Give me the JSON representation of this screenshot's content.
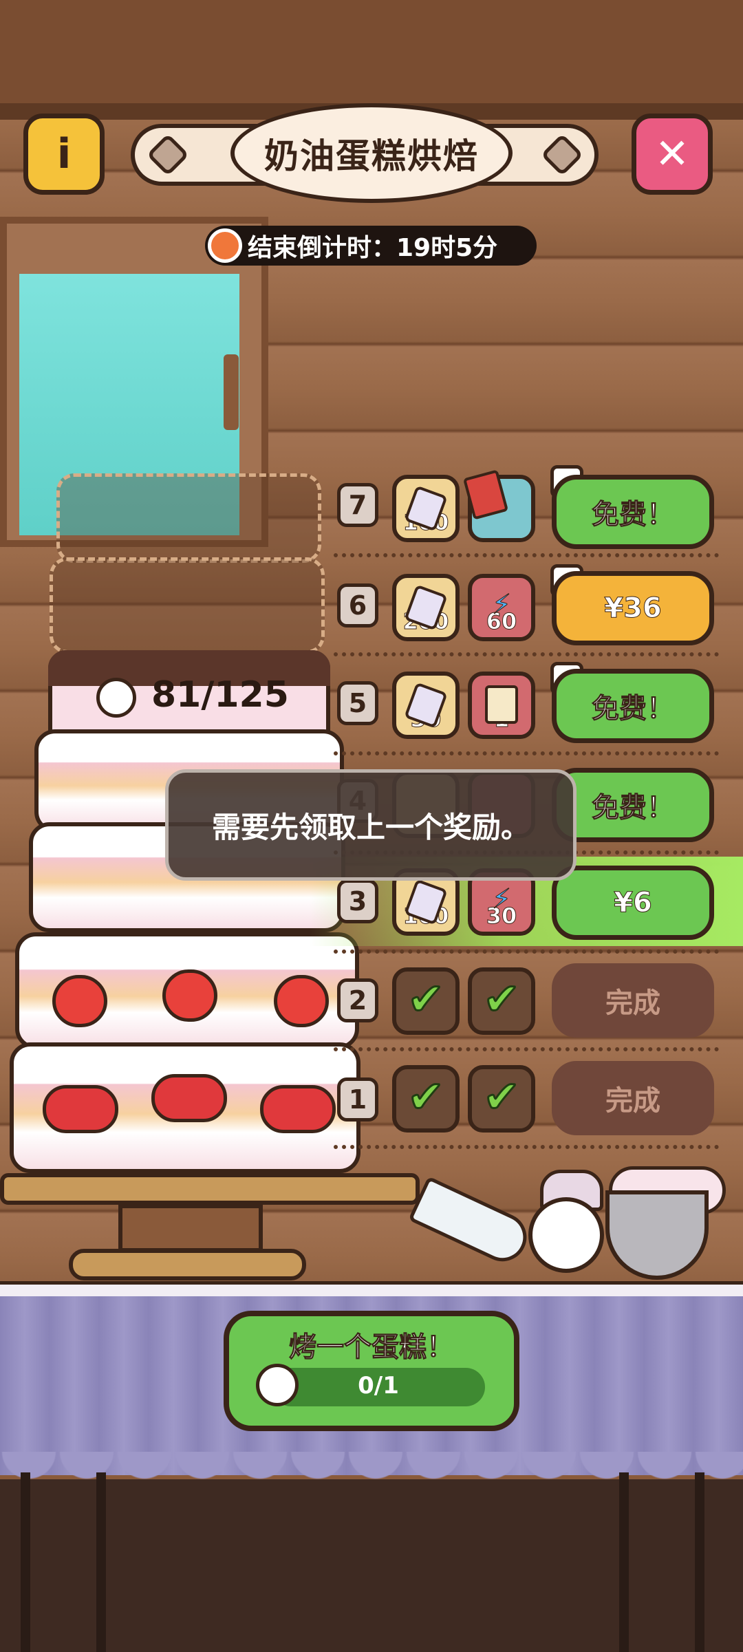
{
  "header": {
    "title": "奶油蛋糕烘焙",
    "info_icon": "i",
    "close_icon": "✕",
    "timer_text": "结束倒计时：19时5分"
  },
  "cake": {
    "progress_text": "81/125"
  },
  "rewards": [
    {
      "level": "7",
      "slot1": "100",
      "slot2": "",
      "action": "免费！",
      "locked": true
    },
    {
      "level": "6",
      "slot1": "200",
      "slot2": "60",
      "action": "¥36",
      "locked": true
    },
    {
      "level": "5",
      "slot1": "30",
      "slot2": "1",
      "action": "免费！",
      "locked": true
    },
    {
      "level": "4",
      "slot1": "",
      "slot2": "",
      "action": "免费！",
      "locked": false
    },
    {
      "level": "3",
      "slot1": "100",
      "slot2": "30",
      "action": "¥6",
      "locked": false
    },
    {
      "level": "2",
      "slot1": "",
      "slot2": "",
      "action": "完成",
      "locked": false
    },
    {
      "level": "1",
      "slot1": "",
      "slot2": "",
      "action": "完成",
      "locked": false
    }
  ],
  "toast": {
    "message": "需要先领取上一个奖励。"
  },
  "bake": {
    "label": "烤一个蛋糕！",
    "progress": "0/1"
  },
  "colors": {
    "green_button": "#6cc752",
    "orange_button": "#f4b33a",
    "done_button": "#70473a",
    "close_button": "#ea5b82",
    "info_button": "#f5c23a"
  }
}
